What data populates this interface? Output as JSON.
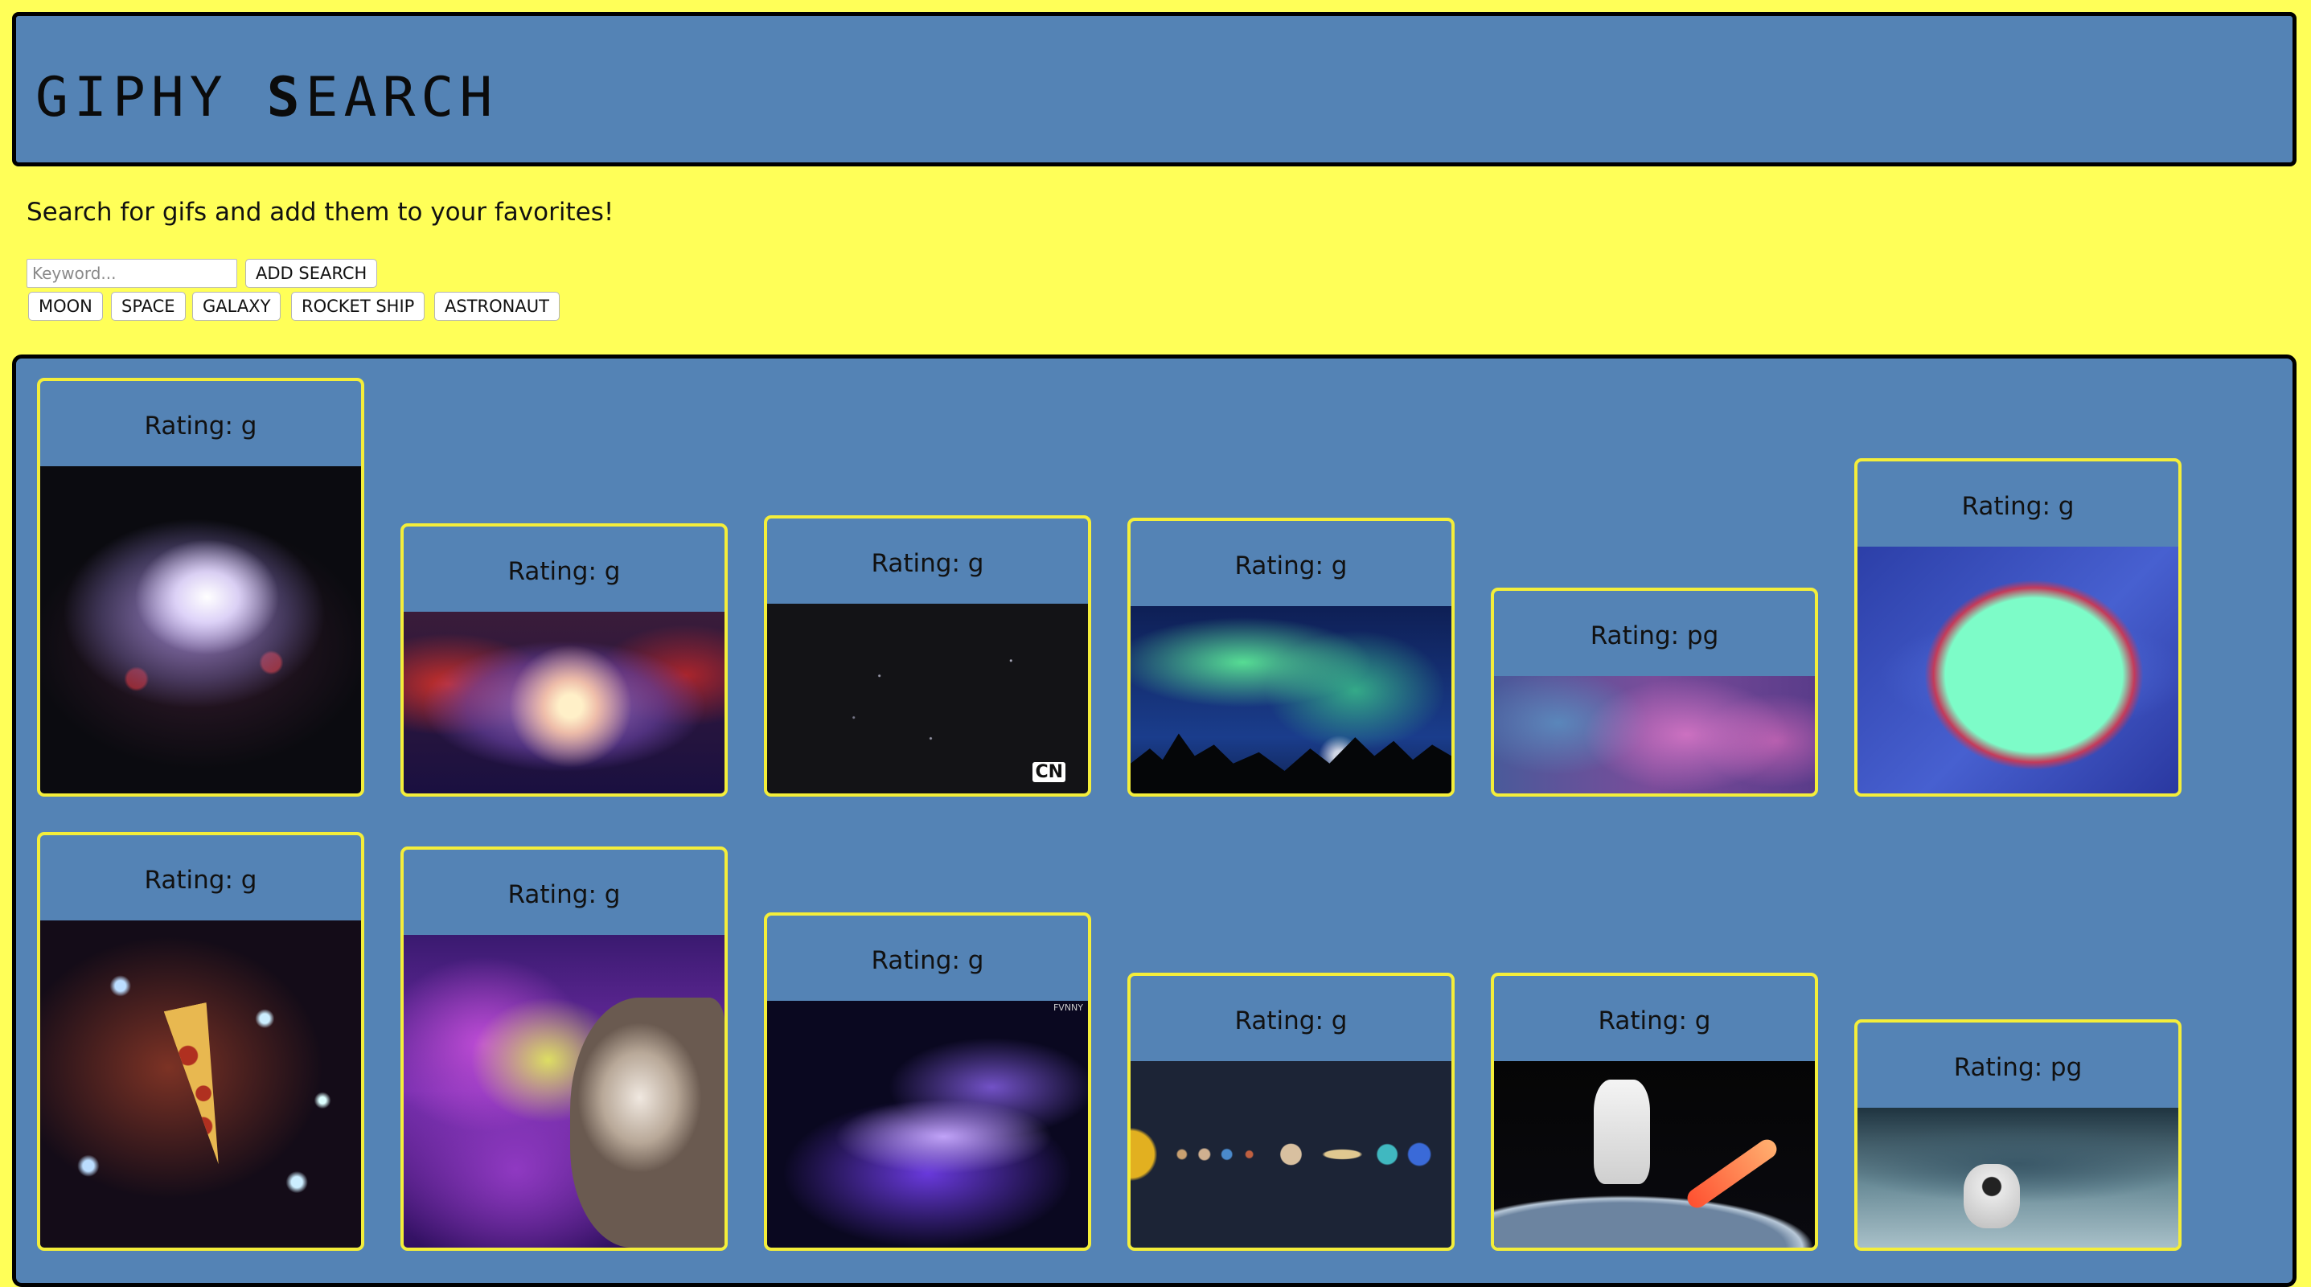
{
  "header": {
    "title_pre": "GIPHY ",
    "title_accent": "S",
    "title_post": "EARCH"
  },
  "intro": "Search for gifs and add them to your favorites!",
  "search": {
    "placeholder": "Keyword...",
    "add_label": "ADD SEARCH"
  },
  "topics": [
    "MOON",
    "SPACE",
    "GALAXY",
    "ROCKET SHIP",
    "ASTRONAUT"
  ],
  "colors": {
    "page_bg": "#ffff58",
    "panel_bg": "#5483b5",
    "card_border": "#f4ee3a",
    "panel_border": "#000000"
  },
  "results": [
    {
      "rating": "Rating: g",
      "content": "purple galaxy nebula"
    },
    {
      "rating": "Rating: g",
      "content": "red and blue spiral galaxy"
    },
    {
      "rating": "Rating: g",
      "content": "dark starfield",
      "watermark": "CN"
    },
    {
      "rating": "Rating: g",
      "content": "green aurora over trees"
    },
    {
      "rating": "Rating: pg",
      "content": "purple nebula band"
    },
    {
      "rating": "Rating: g",
      "content": "mint green planet with rings"
    },
    {
      "rating": "Rating: g",
      "content": "pizza slice in space"
    },
    {
      "rating": "Rating: g",
      "content": "cat in colorful nebula"
    },
    {
      "rating": "Rating: g",
      "content": "blue spiral galaxy",
      "watermark": "FVNNY"
    },
    {
      "rating": "Rating: g",
      "content": "solar system planets"
    },
    {
      "rating": "Rating: g",
      "content": "astronaut above earth"
    },
    {
      "rating": "Rating: pg",
      "content": "astronaut on icy planet"
    }
  ]
}
